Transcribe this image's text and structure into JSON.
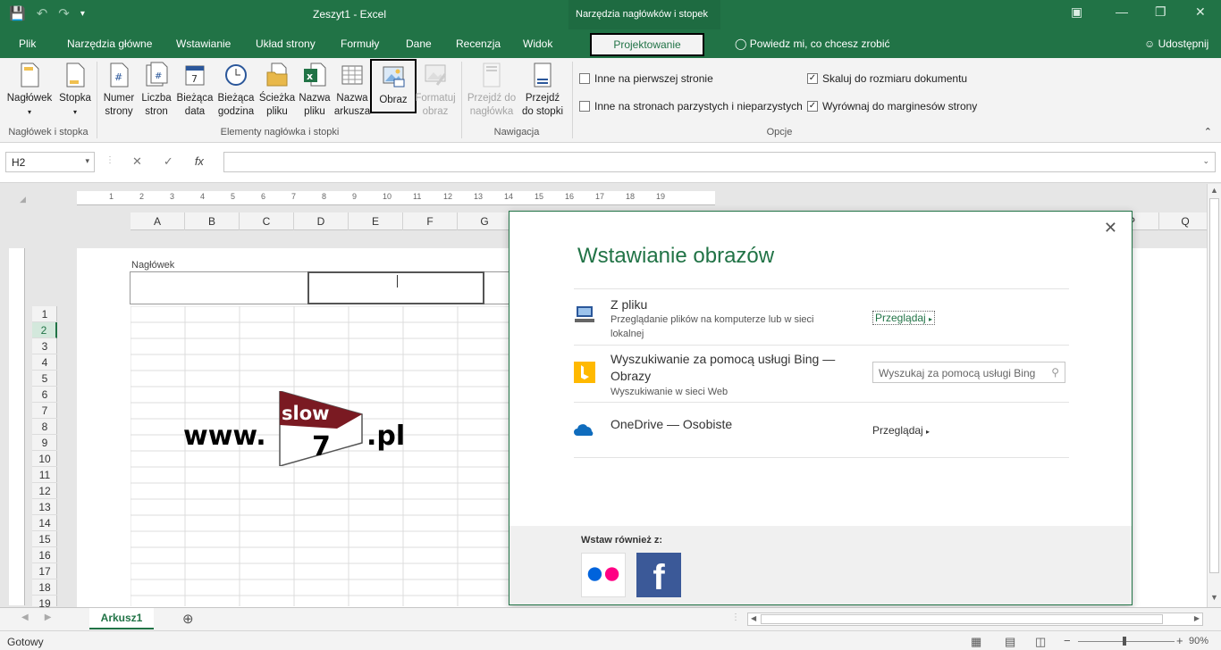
{
  "window": {
    "title": "Zeszyt1 - Excel",
    "context_title": "Narzędzia nagłówków i stopek"
  },
  "tabs": [
    "Plik",
    "Narzędzia główne",
    "Wstawianie",
    "Układ strony",
    "Formuły",
    "Dane",
    "Recenzja",
    "Widok"
  ],
  "active_tab": "Projektowanie",
  "tellme": "Powiedz mi, co chcesz zrobić",
  "share": "Udostępnij",
  "ribbon": {
    "naglowek": "Nagłówek",
    "stopka": "Stopka",
    "group1": "Nagłówek i stopka",
    "numer1": "Numer",
    "numer2": "strony",
    "liczba1": "Liczba",
    "liczba2": "stron",
    "data1": "Bieżąca",
    "data2": "data",
    "godz1": "Bieżąca",
    "godz2": "godzina",
    "sciezka1": "Ścieżka",
    "sciezka2": "pliku",
    "nazwa1": "Nazwa",
    "nazwa2": "pliku",
    "ark1": "Nazwa",
    "ark2": "arkusza",
    "obraz": "Obraz",
    "format1": "Formatuj",
    "format2": "obraz",
    "group2": "Elementy nagłówka i stopki",
    "przejdz_nag1": "Przejdź do",
    "przejdz_nag2": "nagłówka",
    "przejdz_st1": "Przejdź",
    "przejdz_st2": "do stopki",
    "group3": "Nawigacja",
    "opt1": "Inne na pierwszej stronie",
    "opt2": "Inne na stronach parzystych i nieparzystych",
    "opt3": "Skaluj do rozmiaru dokumentu",
    "opt4": "Wyrównaj do marginesów strony",
    "group4": "Opcje"
  },
  "formula_bar": {
    "name_box": "H2",
    "fx": "fx"
  },
  "sheet": {
    "columns": [
      "A",
      "B",
      "C",
      "D",
      "E",
      "F",
      "G",
      "P",
      "Q"
    ],
    "rows": [
      "1",
      "2",
      "3",
      "4",
      "5",
      "6",
      "7",
      "8",
      "9",
      "10",
      "11",
      "12",
      "13",
      "14",
      "15",
      "16",
      "17",
      "18",
      "19"
    ],
    "header_label": "Nagłówek",
    "logo_left": "www.",
    "logo_top": "slow",
    "logo_num": "7",
    "logo_right": ".pl"
  },
  "dialog": {
    "title": "Wstawianie obrazów",
    "file_title": "Z pliku",
    "file_sub": "Przeglądanie plików na komputerze lub w sieci lokalnej",
    "file_link": "Przeglądaj",
    "bing_title": "Wyszukiwanie za pomocą usługi Bing — Obrazy",
    "bing_sub": "Wyszukiwanie w sieci Web",
    "bing_placeholder": "Wyszukaj za pomocą usługi Bing",
    "onedrive_title": "OneDrive — Osobiste",
    "onedrive_link": "Przeglądaj",
    "footer_label": "Wstaw również z:"
  },
  "sheet_tabs": {
    "active": "Arkusz1"
  },
  "status": {
    "text": "Gotowy",
    "zoom": "90%"
  },
  "colors": {
    "accent": "#217346",
    "facebook": "#3b5998",
    "flickr_blue": "#0063dc",
    "flickr_pink": "#ff0084",
    "bing": "#ffb900",
    "onedrive": "#0f6cbd"
  }
}
